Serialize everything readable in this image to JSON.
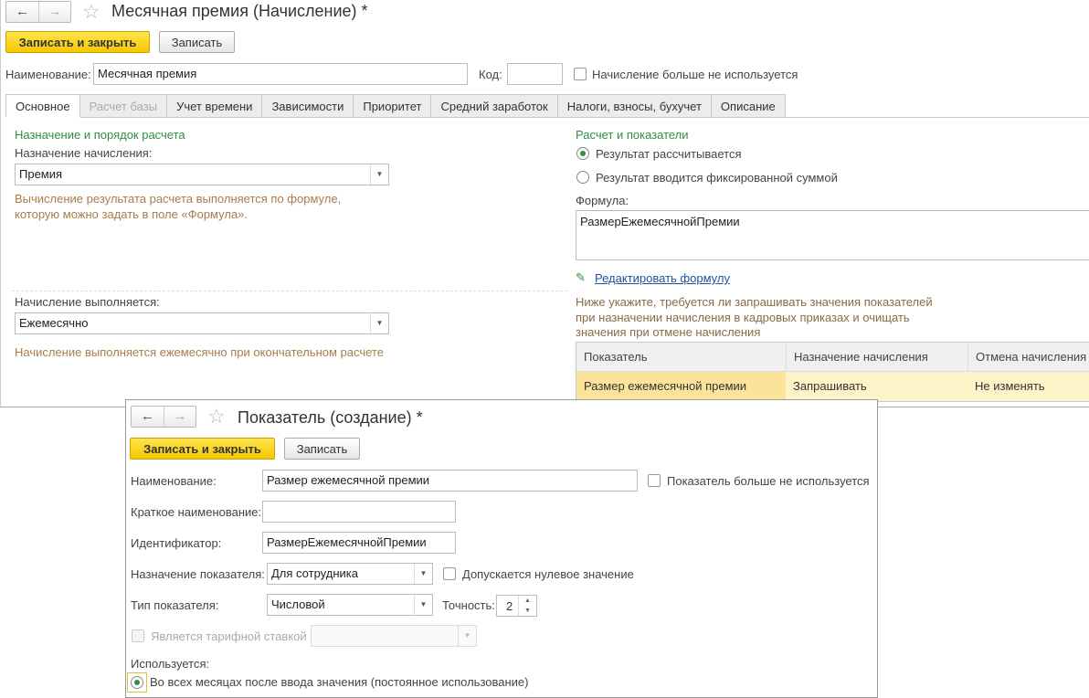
{
  "window1": {
    "title": "Месячная премия (Начисление) *",
    "save_close_label": "Записать и закрыть",
    "save_label": "Записать",
    "name_label": "Наименование:",
    "name_value": "Месячная премия",
    "code_label": "Код:",
    "code_value": "",
    "not_used_label": "Начисление больше не используется",
    "tabs": [
      {
        "label": "Основное"
      },
      {
        "label": "Расчет базы"
      },
      {
        "label": "Учет времени"
      },
      {
        "label": "Зависимости"
      },
      {
        "label": "Приоритет"
      },
      {
        "label": "Средний заработок"
      },
      {
        "label": "Налоги, взносы, бухучет"
      },
      {
        "label": "Описание"
      }
    ],
    "left": {
      "section_title": "Назначение и порядок расчета",
      "purpose_label": "Назначение начисления:",
      "purpose_value": "Премия",
      "purpose_hint_1": "Вычисление результата расчета выполняется по формуле,",
      "purpose_hint_2": "которую можно задать в поле «Формула».",
      "period_label": "Начисление выполняется:",
      "period_value": "Ежемесячно",
      "period_hint": "Начисление выполняется ежемесячно при окончательном расчете"
    },
    "right": {
      "section_title": "Расчет и показатели",
      "radio_calc": "Результат рассчитывается",
      "radio_fixed": "Результат вводится фиксированной суммой",
      "formula_label": "Формула:",
      "formula_value": "РазмерЕжемесячнойПремии",
      "edit_formula_link": "Редактировать формулу",
      "hint_1": "Ниже укажите, требуется ли запрашивать значения показателей",
      "hint_2": "при назначении начисления в кадровых приказах и очищать",
      "hint_3": "значения при отмене начисления",
      "grid_headers": [
        "Показатель",
        "Назначение начисления",
        "Отмена начисления"
      ],
      "grid_rows": [
        [
          "Размер ежемесячной премии",
          "Запрашивать",
          "Не изменять"
        ]
      ]
    }
  },
  "window2": {
    "title": "Показатель (создание) *",
    "save_close_label": "Записать и закрыть",
    "save_label": "Записать",
    "name_label": "Наименование:",
    "name_value": "Размер ежемесячной премии",
    "not_used_label": "Показатель больше не используется",
    "short_name_label": "Краткое наименование:",
    "short_name_value": "",
    "id_label": "Идентификатор:",
    "id_value": "РазмерЕжемесячнойПремии",
    "purpose_label": "Назначение показателя:",
    "purpose_value": "Для сотрудника",
    "zero_allowed_label": "Допускается нулевое значение",
    "type_label": "Тип показателя:",
    "type_value": "Числовой",
    "precision_label": "Точность:",
    "precision_value": "2",
    "tariff_label": "Является тарифной ставкой",
    "used_label": "Используется:",
    "used_option": "Во всех месяцах после ввода значения (постоянное использование)"
  },
  "colors": {
    "primary_button": "#f5c800",
    "section_green": "#2f8f3f",
    "hint_brown": "#a87c4a",
    "link_blue": "#1f4f9f",
    "arrow_red": "#e03030",
    "selected_row": "#fdf3c8"
  },
  "icons": {
    "back": "←",
    "forward": "→",
    "star": "☆",
    "dropdown": "▼",
    "pencil": "✎"
  }
}
